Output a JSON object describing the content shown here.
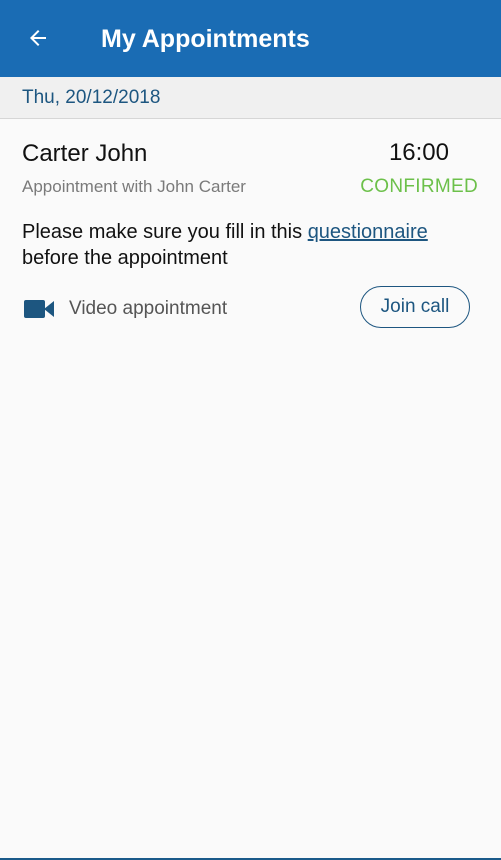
{
  "app_bar": {
    "title": "My Appointments",
    "back_icon": "arrow-left-icon",
    "color": "#1a6cb4"
  },
  "date_header": {
    "date": "Thu, 20/12/2018"
  },
  "appointment": {
    "name": "Carter John",
    "time": "16:00",
    "subtitle": "Appointment with John Carter",
    "status": "CONFIRMED",
    "status_color": "#6cc04a",
    "note_prefix": "Please make sure you fill in this ",
    "note_link": "questionnaire",
    "note_suffix": "before the appointment",
    "type_icon": "videocam-icon",
    "type_label": "Video appointment",
    "join_label": "Join call"
  }
}
